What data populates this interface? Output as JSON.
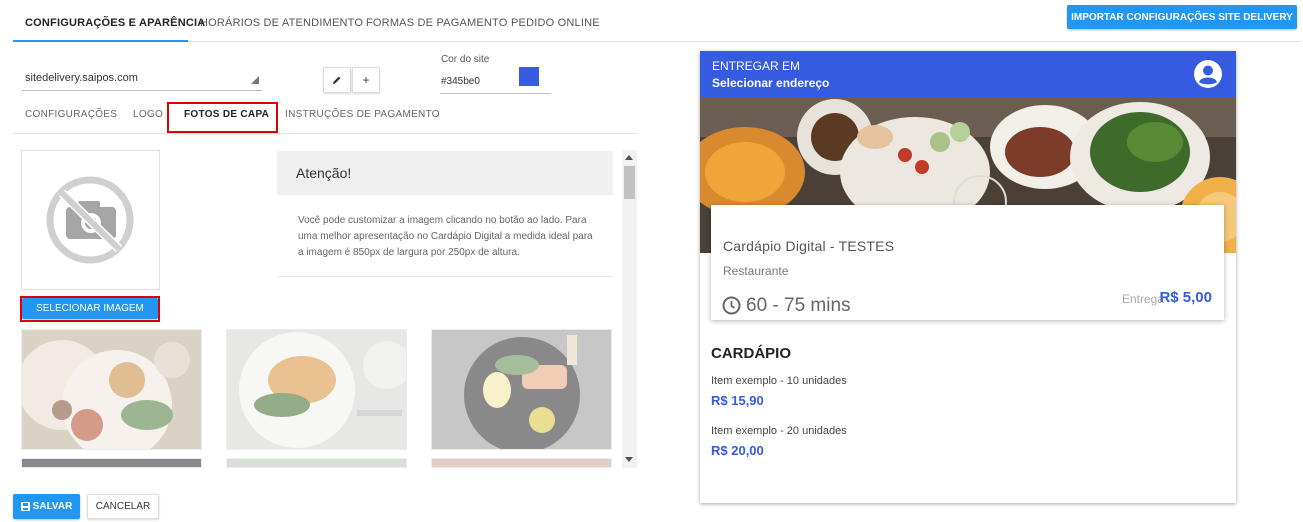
{
  "top_tabs": [
    "CONFIGURAÇÕES E APARÊNCIA",
    "HORÁRIOS DE ATENDIMENTO",
    "FORMAS DE PAGAMENTO",
    "PEDIDO ONLINE"
  ],
  "import_button": "IMPORTAR CONFIGURAÇÕES SITE DELIVERY",
  "site_select": {
    "value": "sitedelivery.saipos.com"
  },
  "edit_button_icon": "pencil-icon",
  "add_button_label": "+",
  "site_color": {
    "label": "Cor do site",
    "value": "#345be0"
  },
  "sub_tabs": [
    "CONFIGURAÇÕES",
    "LOGO",
    "FOTOS DE CAPA",
    "INSTRUÇÕES DE PAGAMENTO"
  ],
  "select_image_button": "SELECIONAR IMAGEM",
  "notice": {
    "title": "Atenção!",
    "body": "Você pode customizar a imagem clicando no botão ao lado. Para uma melhor apresentação no Cardápio Digital a medida ideal para a imagem é 850px de largura por 250px de altura."
  },
  "save_button": "SALVAR",
  "cancel_button": "CANCELAR",
  "preview": {
    "deliver_label": "ENTREGAR EM",
    "address_label": "Selecionar endereço",
    "store_name": "Cardápio Digital - TESTES",
    "store_type": "Restaurante",
    "delivery_time": "60 - 75 mins",
    "delivery_label": "Entrega",
    "delivery_fee": "R$ 5,00",
    "menu_title": "CARDÁPIO",
    "menu_items": [
      {
        "name": "Item exemplo - 10 unidades",
        "price": "R$ 15,90"
      },
      {
        "name": "Item exemplo - 20 unidades",
        "price": "R$ 20,00"
      }
    ]
  },
  "colors": {
    "primary_button": "#2196f3",
    "site_color": "#345be0",
    "highlight": "#e00000"
  }
}
